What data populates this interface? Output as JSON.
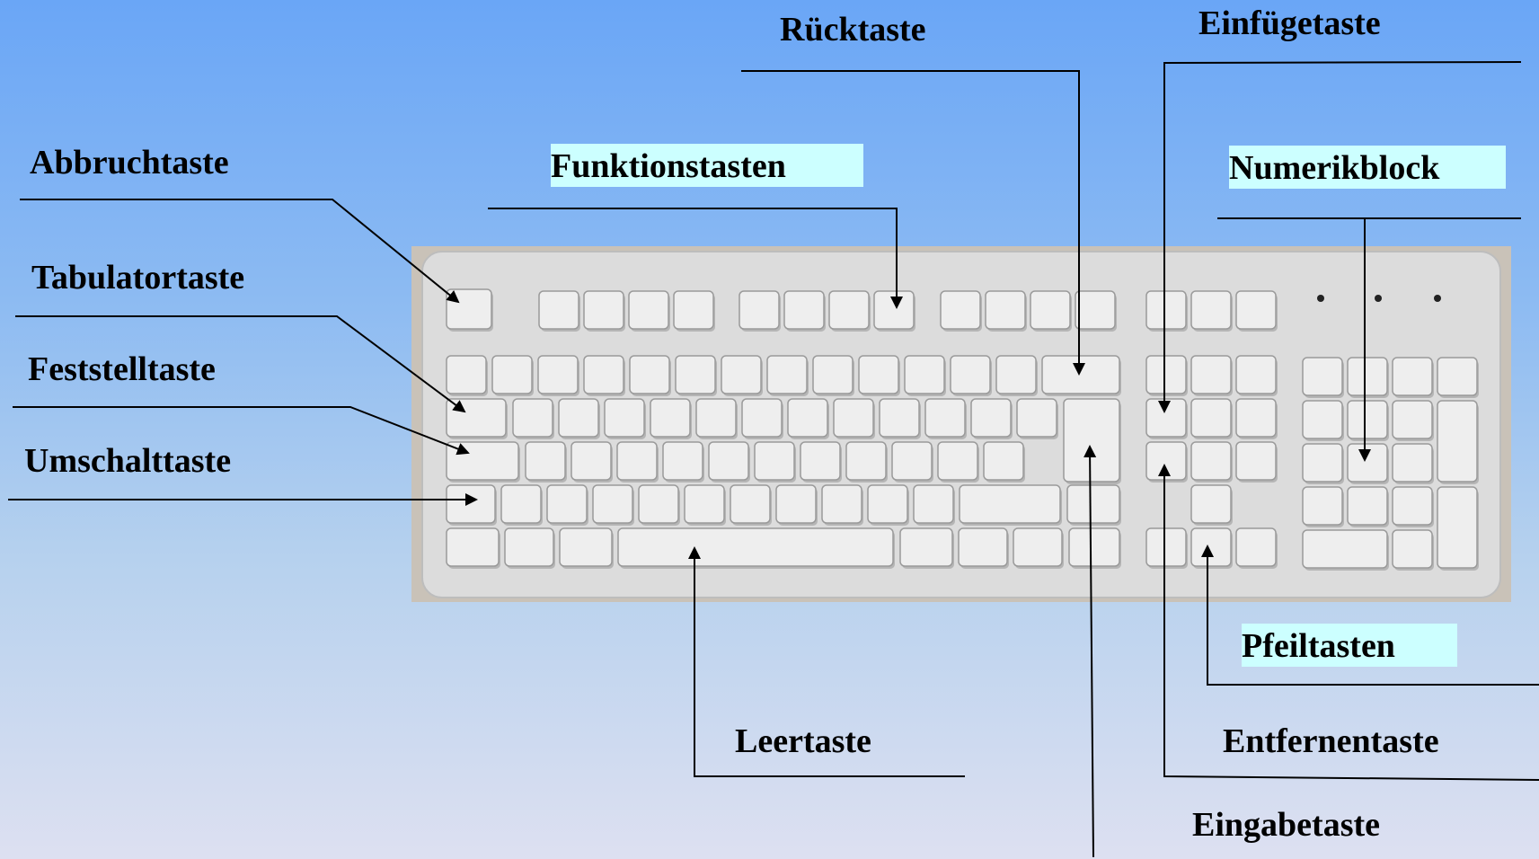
{
  "labels": {
    "ruecktaste": "Rücktaste",
    "einfuegetaste": "Einfügetaste",
    "abbruchtaste": "Abbruchtaste",
    "funktionstasten": "Funktionstasten",
    "numerikblock": "Numerikblock",
    "tabulatortaste": "Tabulatortaste",
    "feststelltaste": "Feststelltaste",
    "umschalttaste": "Umschalttaste",
    "pfeiltasten": "Pfeiltasten",
    "leertaste": "Leertaste",
    "entfernentaste": "Entfernentaste",
    "eingabetaste": "Eingabetaste"
  },
  "colors": {
    "label_highlight": "#ccffff",
    "keyboard_body": "#dcdcdc",
    "key_face": "#eeeeee"
  },
  "image": {
    "subject": "keyboard"
  }
}
